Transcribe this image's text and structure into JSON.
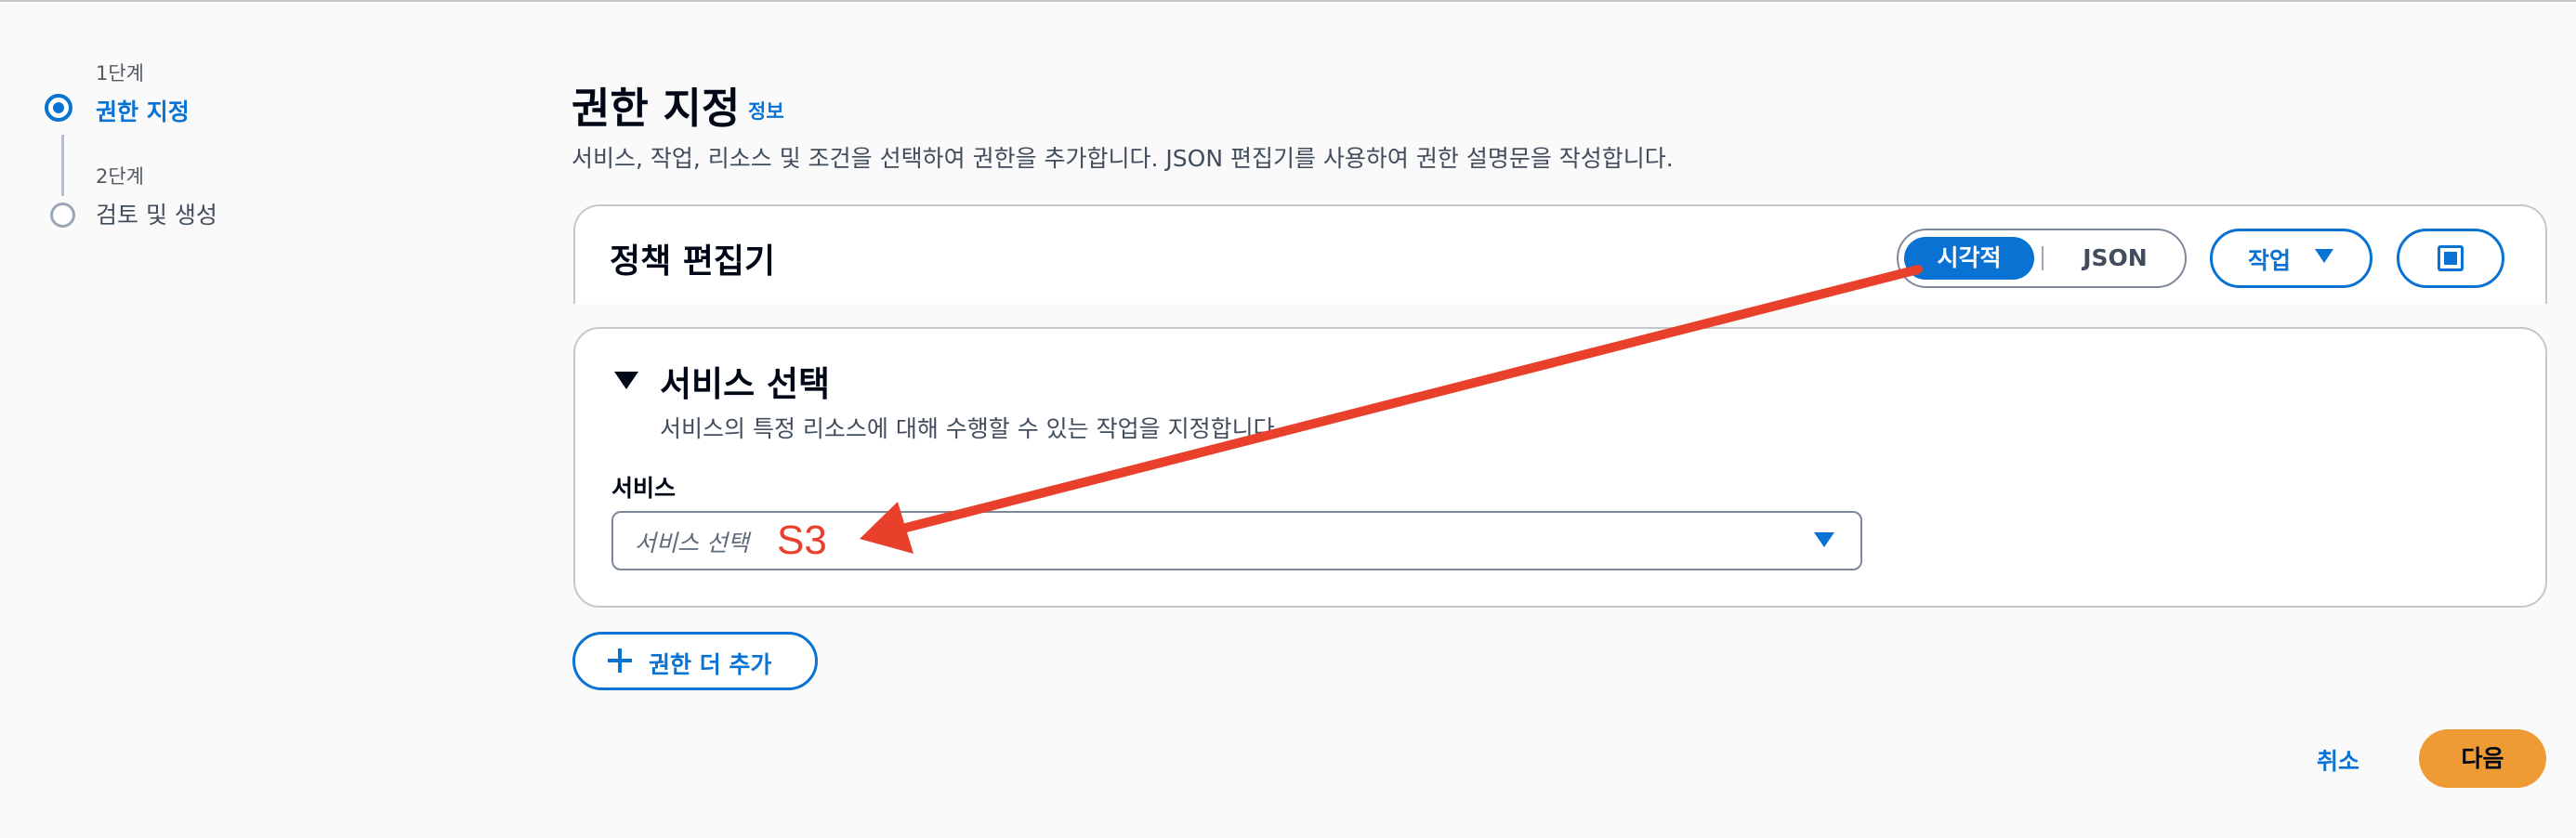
{
  "wizard": {
    "steps": [
      {
        "number": "1단계",
        "label": "권한 지정",
        "state": "active"
      },
      {
        "number": "2단계",
        "label": "검토 및 생성",
        "state": "inactive"
      }
    ]
  },
  "header": {
    "title": "권한 지정",
    "info_link": "정보",
    "description": "서비스, 작업, 리소스 및 조건을 선택하여 권한을 추가합니다. JSON 편집기를 사용하여 권한 설명문을 작성합니다."
  },
  "policy_editor": {
    "title": "정책 편집기",
    "mode_toggle": {
      "options": [
        "시각적",
        "JSON"
      ],
      "selected": "시각적"
    },
    "actions_label": "작업",
    "fullscreen_icon": "fullscreen-icon"
  },
  "service_section": {
    "title": "서비스 선택",
    "description": "서비스의 특정 리소스에 대해 수행할 수 있는 작업을 지정합니다.",
    "field_label": "서비스",
    "select_placeholder": "서비스 선택"
  },
  "annotation": {
    "text": "S3",
    "color": "#e8402a"
  },
  "add_permissions_label": "권한 더 추가",
  "footer": {
    "cancel_label": "취소",
    "next_label": "다음"
  },
  "colors": {
    "accent": "#0972d3",
    "primary_button": "#ef9b35",
    "annotation": "#e8402a"
  }
}
